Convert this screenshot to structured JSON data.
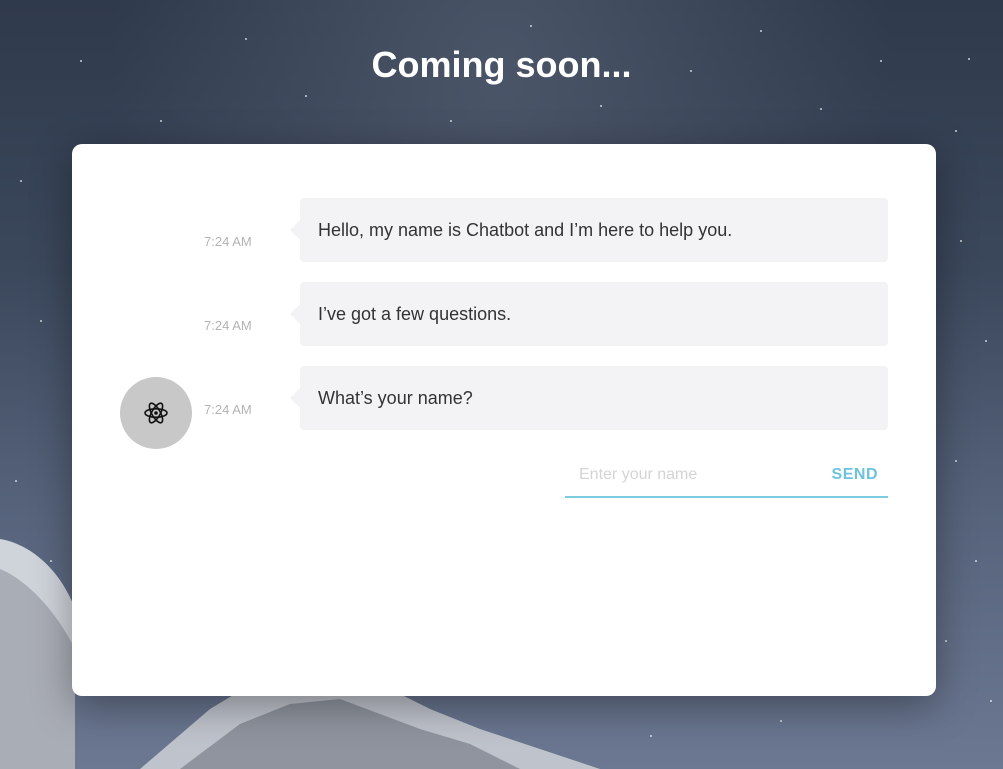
{
  "page": {
    "title": "Coming soon..."
  },
  "chat": {
    "avatar_icon": "atom-icon",
    "messages": [
      {
        "time": "7:24 AM",
        "text": "Hello, my name is Chatbot and I’m here to help you."
      },
      {
        "time": "7:24 AM",
        "text": "I’ve got a few questions."
      },
      {
        "time": "7:24 AM",
        "text": "What’s your name?"
      }
    ],
    "input": {
      "placeholder": "Enter your name",
      "value": ""
    },
    "send_label": "SEND"
  },
  "colors": {
    "accent": "#6cc3df",
    "bubble_bg": "#f3f3f5",
    "avatar_bg": "#c8c8c8"
  }
}
